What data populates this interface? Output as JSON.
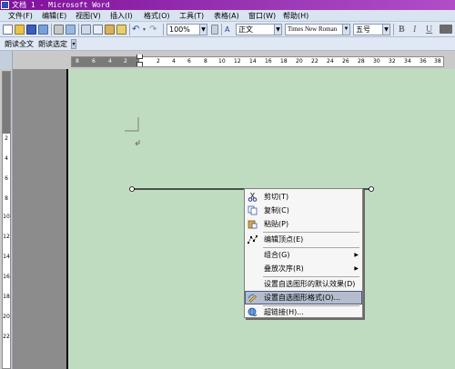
{
  "window": {
    "title": "文档 1 - Microsoft Word"
  },
  "menubar": {
    "items": [
      "文件(F)",
      "编辑(E)",
      "视图(V)",
      "插入(I)",
      "格式(O)",
      "工具(T)",
      "表格(A)",
      "窗口(W)",
      "帮助(H)"
    ]
  },
  "toolbar": {
    "zoom": "100%",
    "style": "正文",
    "font": "Times New Roman",
    "size": "五号",
    "bold": "B",
    "italic": "I",
    "underline": "U"
  },
  "toolbar2": {
    "read_all": "朗读全文",
    "read_selection": "朗读选定"
  },
  "ruler": {
    "h_left_numbers": [
      "8",
      "6",
      "4",
      "2"
    ],
    "h_right_numbers": [
      "2",
      "4",
      "6",
      "8",
      "10",
      "12",
      "14",
      "16",
      "18",
      "20",
      "22",
      "24",
      "26",
      "28",
      "30",
      "32",
      "34",
      "36",
      "38"
    ],
    "v_numbers": [
      "2",
      "4",
      "6",
      "8",
      "10",
      "12",
      "14",
      "16",
      "18",
      "20",
      "22"
    ]
  },
  "context_menu": {
    "items": [
      {
        "label": "剪切(T)",
        "icon": "scissors-icon"
      },
      {
        "label": "复制(C)",
        "icon": "copy-icon"
      },
      {
        "label": "粘贴(P)",
        "icon": "paste-icon"
      },
      {
        "label": "编辑顶点(E)",
        "icon": "edit-points-icon"
      },
      {
        "label": "组合(G)",
        "icon": "",
        "submenu": "▶"
      },
      {
        "label": "叠放次序(R)",
        "icon": "",
        "submenu": "▶"
      },
      {
        "label": "设置自选图形的默认效果(D)",
        "icon": ""
      },
      {
        "label": "设置自选图形格式(O)...",
        "icon": "format-shape-icon"
      },
      {
        "label": "超链接(H)...",
        "icon": "hyperlink-icon"
      }
    ]
  },
  "colors": {
    "page_bg": "#c0dcc0",
    "title_bar": "#8a1fa6",
    "menu_highlight": "#b4bcce"
  }
}
